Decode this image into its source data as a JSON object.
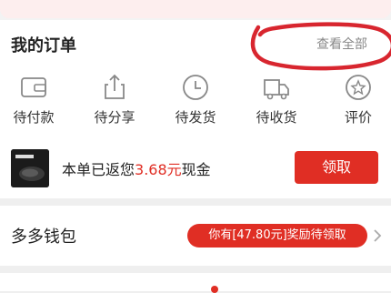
{
  "orders": {
    "title": "我的订单",
    "view_all": "查看全部",
    "statuses": [
      {
        "label": "待付款",
        "icon": "wallet-icon"
      },
      {
        "label": "待分享",
        "icon": "share-icon"
      },
      {
        "label": "待发货",
        "icon": "clock-icon"
      },
      {
        "label": "待收货",
        "icon": "truck-icon"
      },
      {
        "label": "评价",
        "icon": "star-badge-icon"
      }
    ],
    "cashback": {
      "prefix": "本单已返您",
      "amount": "3.68元",
      "suffix": "现金",
      "claim_label": "领取"
    }
  },
  "wallet": {
    "title": "多多钱包",
    "reward_text": "你有[47.80元]奖励待领取"
  },
  "colors": {
    "accent": "#e02e24",
    "annotation": "#d8262f"
  }
}
